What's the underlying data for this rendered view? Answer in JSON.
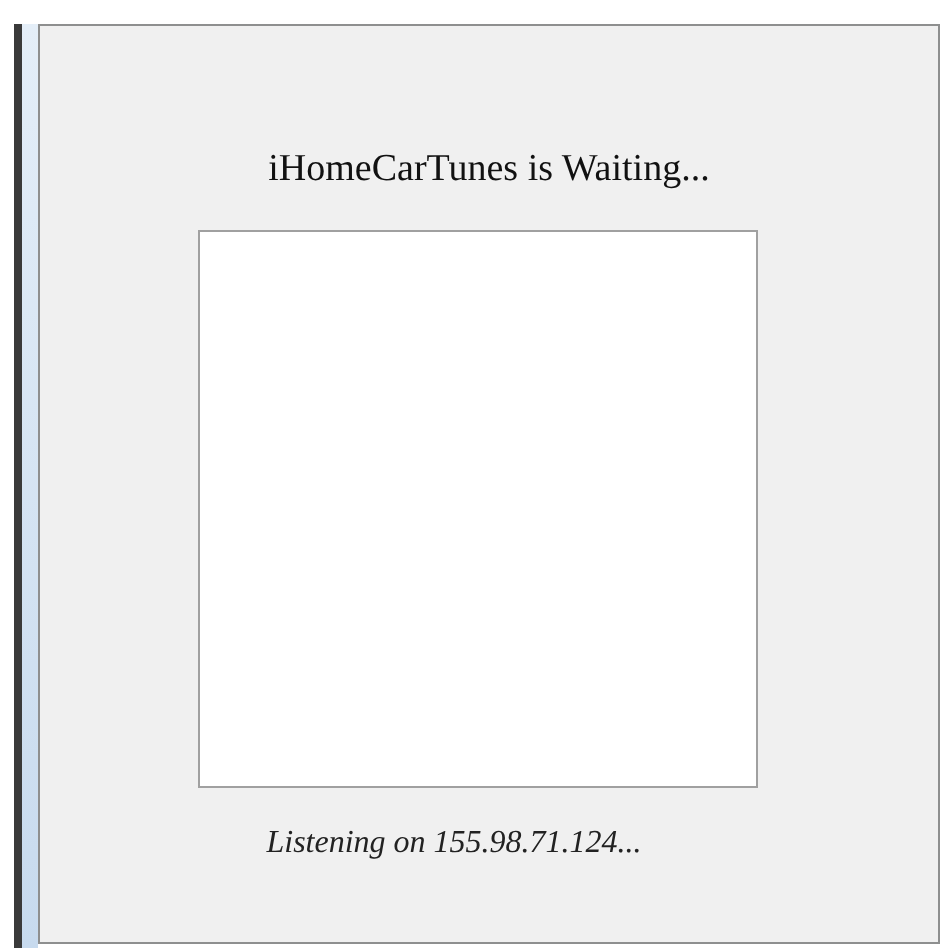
{
  "window": {
    "title": "iHomeCarTunes is Waiting..."
  },
  "status": "Listening on 155.98.71.124..."
}
